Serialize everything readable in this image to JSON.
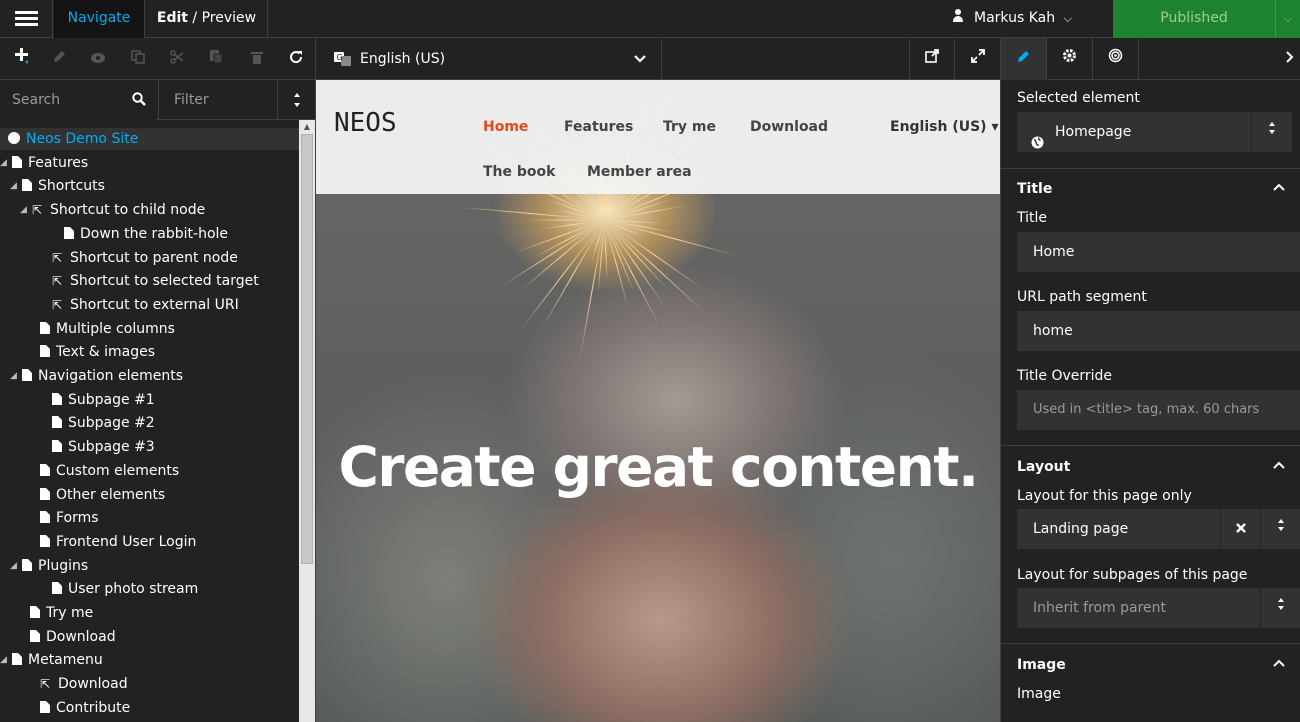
{
  "topbar": {
    "tabs": {
      "navigate": "Navigate",
      "edit": "Edit",
      "preview": "Preview",
      "separator": "/"
    },
    "user_name": "Markus Kah",
    "publish_label": "Published"
  },
  "left_panel": {
    "search_placeholder": "Search",
    "filter_label": "Filter",
    "tree": [
      {
        "label": "Neos Demo Site",
        "type": "root"
      },
      {
        "label": "Features",
        "type": "page"
      },
      {
        "label": "Shortcuts",
        "type": "page"
      },
      {
        "label": "Shortcut to child node",
        "type": "shortcut"
      },
      {
        "label": "Down the rabbit-hole",
        "type": "page"
      },
      {
        "label": "Shortcut to parent node",
        "type": "shortcut"
      },
      {
        "label": "Shortcut to selected target",
        "type": "shortcut"
      },
      {
        "label": "Shortcut to external URI",
        "type": "shortcut"
      },
      {
        "label": "Multiple columns",
        "type": "page"
      },
      {
        "label": "Text & images",
        "type": "page"
      },
      {
        "label": "Navigation elements",
        "type": "page"
      },
      {
        "label": "Subpage #1",
        "type": "page"
      },
      {
        "label": "Subpage #2",
        "type": "page"
      },
      {
        "label": "Subpage #3",
        "type": "page"
      },
      {
        "label": "Custom elements",
        "type": "page"
      },
      {
        "label": "Other elements",
        "type": "page"
      },
      {
        "label": "Forms",
        "type": "page"
      },
      {
        "label": "Frontend User Login",
        "type": "page"
      },
      {
        "label": "Plugins",
        "type": "page"
      },
      {
        "label": "User photo stream",
        "type": "page"
      },
      {
        "label": "Try me",
        "type": "page"
      },
      {
        "label": "Download",
        "type": "page"
      },
      {
        "label": "Metamenu",
        "type": "page"
      },
      {
        "label": "Download",
        "type": "shortcut"
      },
      {
        "label": "Contribute",
        "type": "page"
      }
    ]
  },
  "content": {
    "dimension_label": "English (US)",
    "site": {
      "logo": "NEOS",
      "nav": [
        "Home",
        "Features",
        "Try me",
        "Download",
        "The book",
        "Member area"
      ],
      "language": "English (US) ▾",
      "headline": "Create great content."
    }
  },
  "inspector": {
    "selected_element_label": "Selected element",
    "selected_element_value": "Homepage",
    "title_section": {
      "header": "Title",
      "title_label": "Title",
      "title_value": "Home",
      "url_label": "URL path segment",
      "url_value": "home",
      "override_label": "Title Override",
      "override_placeholder": "Used in <title> tag, max. 60 chars"
    },
    "layout_section": {
      "header": "Layout",
      "page_layout_label": "Layout for this page only",
      "page_layout_value": "Landing page",
      "subpages_label": "Layout for subpages of this page",
      "subpages_placeholder": "Inherit from parent"
    },
    "image_section": {
      "header": "Image",
      "image_label": "Image"
    }
  },
  "colors": {
    "accent": "#00adee",
    "publish_bg": "#1e8331",
    "panel_bg": "#222222",
    "field_bg": "#323232",
    "site_nav_active": "#e8471a"
  }
}
